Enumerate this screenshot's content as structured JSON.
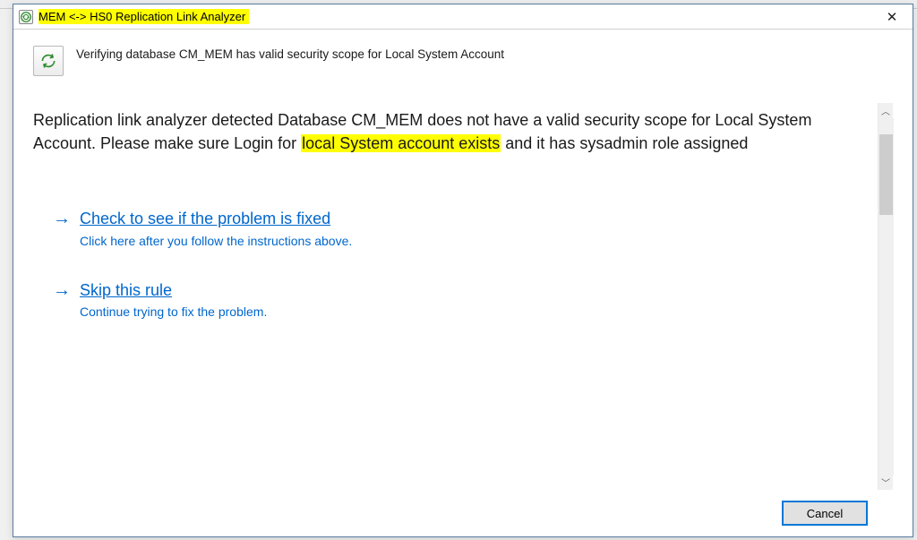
{
  "window": {
    "title": "MEM <-> HS0 Replication Link Analyzer"
  },
  "header": {
    "text": "Verifying database CM_MEM has valid security scope for Local System Account"
  },
  "message": {
    "part1": "Replication link analyzer detected Database CM_MEM does not have a valid security scope for Local System Account. Please make sure Login for ",
    "highlight": "local System account exists",
    "part2": " and it has sysadmin role assigned"
  },
  "actions": {
    "check": {
      "title": "Check to see if the problem is fixed",
      "sub": "Click here after you follow the instructions above."
    },
    "skip": {
      "title": "Skip this rule",
      "sub": "Continue trying to fix the problem."
    }
  },
  "footer": {
    "cancel": "Cancel"
  }
}
